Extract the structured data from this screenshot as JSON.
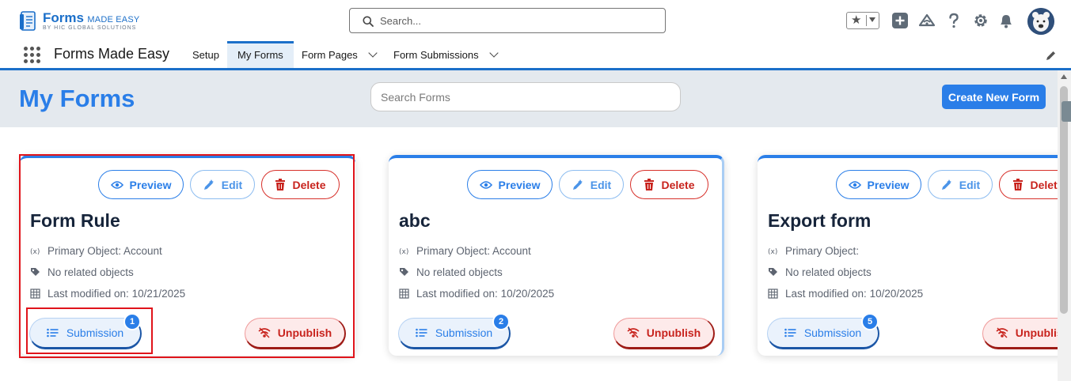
{
  "header": {
    "logo": {
      "title": "Forms",
      "title_suffix": "MADE EASY",
      "subtitle": "BY HIC GLOBAL SOLUTIONS"
    },
    "search_placeholder": "Search...",
    "icons": [
      "favorites-star-icon",
      "add-icon",
      "trailhead-icon",
      "help-icon",
      "settings-icon",
      "bell-icon",
      "user-avatar"
    ]
  },
  "nav": {
    "app_name": "Forms Made Easy",
    "items": [
      {
        "label": "Setup",
        "active": false,
        "dropdown": false
      },
      {
        "label": "My Forms",
        "active": true,
        "dropdown": false
      },
      {
        "label": "Form Pages",
        "active": false,
        "dropdown": true
      },
      {
        "label": "Form Submissions",
        "active": false,
        "dropdown": true
      }
    ]
  },
  "page": {
    "title": "My Forms",
    "search_placeholder": "Search Forms",
    "create_button": "Create New Form"
  },
  "card_labels": {
    "preview": "Preview",
    "edit": "Edit",
    "delete": "Delete",
    "submission": "Submission",
    "unpublish": "Unpublish"
  },
  "cards": [
    {
      "title": "Form Rule",
      "primary_object": "Primary Object: Account",
      "related": "No related objects",
      "modified": "Last modified on: 10/21/2025",
      "submissions": "1"
    },
    {
      "title": "abc",
      "primary_object": "Primary Object: Account",
      "related": "No related objects",
      "modified": "Last modified on: 10/20/2025",
      "submissions": "2"
    },
    {
      "title": "Export form",
      "primary_object": "Primary Object:",
      "related": "No related objects",
      "modified": "Last modified on: 10/20/2025",
      "submissions": "5"
    }
  ],
  "colors": {
    "brand": "#2a7ee8",
    "danger": "#c8231d",
    "highlight": "#e0141b",
    "hero_bg": "#e4e9ee"
  }
}
